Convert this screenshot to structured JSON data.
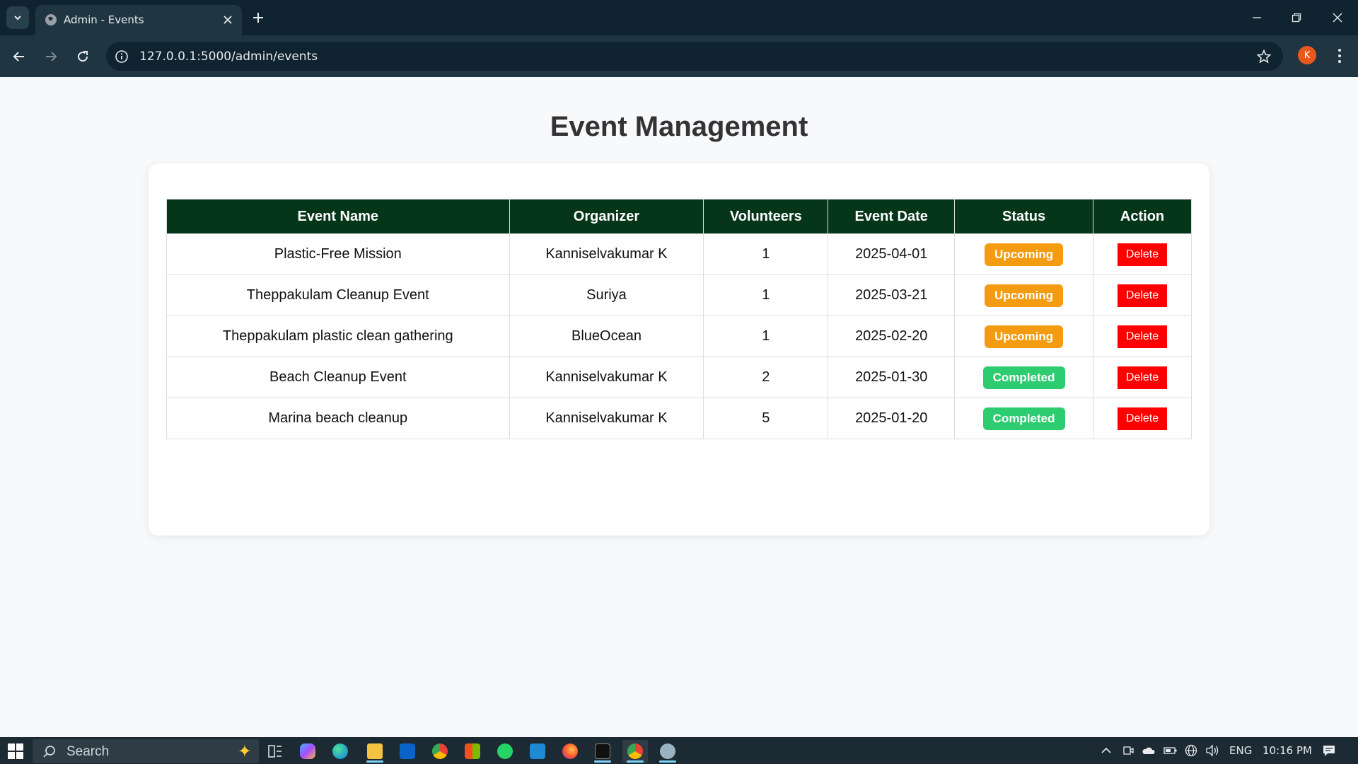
{
  "browser": {
    "tab_title": "Admin - Events",
    "url": "127.0.0.1:5000/admin/events",
    "profile_initial": "K"
  },
  "page": {
    "title": "Event Management",
    "columns": [
      "Event Name",
      "Organizer",
      "Volunteers",
      "Event Date",
      "Status",
      "Action"
    ],
    "rows": [
      {
        "name": "Plastic-Free Mission",
        "organizer": "Kanniselvakumar K",
        "volunteers": "1",
        "date": "2025-04-01",
        "status": "Upcoming",
        "action": "Delete"
      },
      {
        "name": "Theppakulam Cleanup Event",
        "organizer": "Suriya",
        "volunteers": "1",
        "date": "2025-03-21",
        "status": "Upcoming",
        "action": "Delete"
      },
      {
        "name": "Theppakulam plastic clean gathering",
        "organizer": "BlueOcean",
        "volunteers": "1",
        "date": "2025-02-20",
        "status": "Upcoming",
        "action": "Delete"
      },
      {
        "name": "Beach Cleanup Event",
        "organizer": "Kanniselvakumar K",
        "volunteers": "2",
        "date": "2025-01-30",
        "status": "Completed",
        "action": "Delete"
      },
      {
        "name": "Marina beach cleanup",
        "organizer": "Kanniselvakumar K",
        "volunteers": "5",
        "date": "2025-01-20",
        "status": "Completed",
        "action": "Delete"
      }
    ],
    "status_colors": {
      "Upcoming": "#f39c12",
      "Completed": "#2ecc71"
    },
    "header_color": "#06361a",
    "delete_color": "#ff0000"
  },
  "taskbar": {
    "search_placeholder": "Search",
    "language": "ENG",
    "time": "10:16 PM",
    "apps": [
      "task-view-icon",
      "copilot-icon",
      "edge-icon",
      "file-explorer-icon",
      "outlook-icon",
      "chrome-icon",
      "store-icon",
      "whatsapp-icon",
      "vscode-icon",
      "firefox-icon",
      "terminal-icon",
      "chrome-active-icon",
      "app-icon"
    ]
  }
}
